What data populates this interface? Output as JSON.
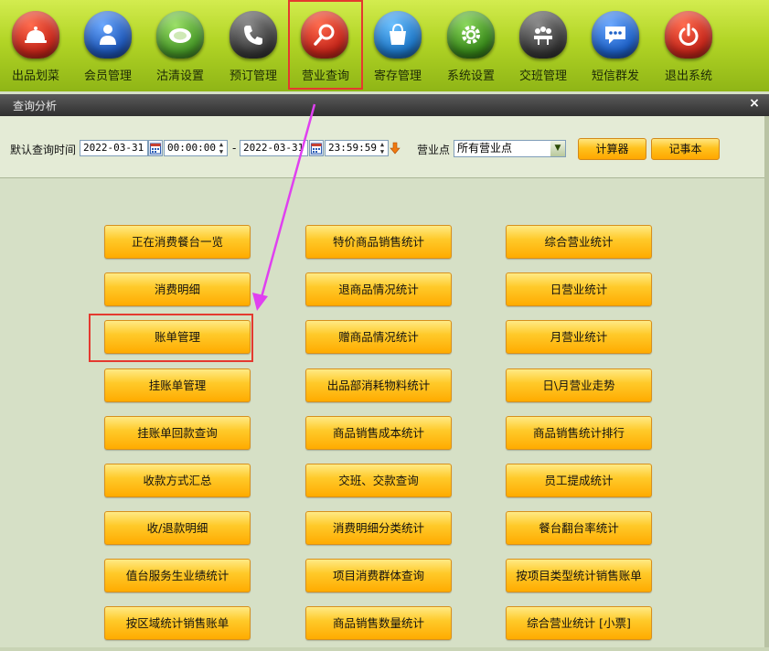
{
  "toolbar": {
    "items": [
      {
        "label": "出品划菜",
        "icon": "food-cover-icon",
        "color": "#c8281c"
      },
      {
        "label": "会员管理",
        "icon": "member-icon",
        "color": "#1f58b8"
      },
      {
        "label": "沽清设置",
        "icon": "plate-icon",
        "color": "#4a9b2a"
      },
      {
        "label": "预订管理",
        "icon": "phone-icon",
        "color": "#3c3c3c"
      },
      {
        "label": "营业查询",
        "icon": "search-icon",
        "color": "#c8281c"
      },
      {
        "label": "寄存管理",
        "icon": "bag-icon",
        "color": "#1f78c8"
      },
      {
        "label": "系统设置",
        "icon": "gear-icon",
        "color": "#3a8a1c"
      },
      {
        "label": "交班管理",
        "icon": "meeting-icon",
        "color": "#3a3a3a"
      },
      {
        "label": "短信群发",
        "icon": "message-icon",
        "color": "#1f62c8"
      },
      {
        "label": "退出系统",
        "icon": "power-icon",
        "color": "#c8281c"
      }
    ]
  },
  "dialog": {
    "title": "查询分析",
    "close": "×"
  },
  "filter": {
    "label_time": "默认查询时间",
    "start_date": "2022-03-31",
    "start_time": "00:00:00",
    "dash": "-",
    "end_date": "2022-03-31",
    "end_time": "23:59:59",
    "label_point": "营业点",
    "point_value": "所有营业点",
    "calc_button": "计算器",
    "notes_button": "记事本"
  },
  "reports": {
    "col1": [
      "正在消费餐台一览",
      "消费明细",
      "账单管理",
      "挂账单管理",
      "挂账单回款查询",
      "收款方式汇总",
      "收/退款明细",
      "值台服务生业绩统计",
      "按区域统计销售账单"
    ],
    "col2": [
      "特价商品销售统计",
      "退商品情况统计",
      "赠商品情况统计",
      "出品部消耗物料统计",
      "商品销售成本统计",
      "交班、交款查询",
      "消费明细分类统计",
      "项目消费群体查询",
      "商品销售数量统计"
    ],
    "col3": [
      "综合营业统计",
      "日营业统计",
      "月营业统计",
      "日\\月营业走势",
      "商品销售统计排行",
      "员工提成统计",
      "餐台翻台率统计",
      "按项目类型统计销售账单",
      "综合营业统计 [小票]"
    ]
  },
  "colors": {
    "highlight": "#e4392f",
    "arrow": "#e040f0",
    "button_gradient_top": "#ffea85",
    "button_gradient_bottom": "#ffab00"
  }
}
